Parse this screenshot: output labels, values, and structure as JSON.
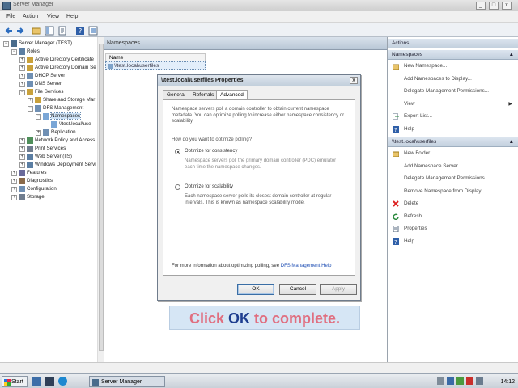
{
  "window": {
    "title": "Server Manager",
    "controls": [
      "_",
      "□",
      "x"
    ]
  },
  "menu": [
    "File",
    "Action",
    "View",
    "Help"
  ],
  "tree": {
    "items": [
      {
        "label": "Server Manager (TEST)",
        "depth": 0,
        "exp": "−"
      },
      {
        "label": "Roles",
        "depth": 1,
        "exp": "−"
      },
      {
        "label": "Active Directory Certificate",
        "depth": 2,
        "exp": "+"
      },
      {
        "label": "Active Directory Domain Se",
        "depth": 2,
        "exp": "+"
      },
      {
        "label": "DHCP Server",
        "depth": 2,
        "exp": "+"
      },
      {
        "label": "DNS Server",
        "depth": 2,
        "exp": "+"
      },
      {
        "label": "File Services",
        "depth": 2,
        "exp": "−"
      },
      {
        "label": "Share and Storage Mar",
        "depth": 3,
        "exp": "+"
      },
      {
        "label": "DFS Management",
        "depth": 3,
        "exp": "−"
      },
      {
        "label": "Namespaces",
        "depth": 4,
        "exp": "−",
        "selected": true
      },
      {
        "label": "\\\\test.local\\use",
        "depth": 5,
        "exp": ""
      },
      {
        "label": "Replication",
        "depth": 4,
        "exp": "+"
      },
      {
        "label": "Network Policy and Access",
        "depth": 2,
        "exp": "+"
      },
      {
        "label": "Print Services",
        "depth": 2,
        "exp": "+"
      },
      {
        "label": "Web Server (IIS)",
        "depth": 2,
        "exp": "+"
      },
      {
        "label": "Windows Deployment Servi",
        "depth": 2,
        "exp": "+"
      },
      {
        "label": "Features",
        "depth": 1,
        "exp": "+"
      },
      {
        "label": "Diagnostics",
        "depth": 1,
        "exp": "+"
      },
      {
        "label": "Configuration",
        "depth": 1,
        "exp": "+"
      },
      {
        "label": "Storage",
        "depth": 1,
        "exp": "+"
      }
    ]
  },
  "center": {
    "header": "Namespaces",
    "column": "Name",
    "row": "\\\\test.local\\userfiles"
  },
  "actions": {
    "title": "Actions",
    "section1": {
      "title": "Namespaces",
      "items": [
        {
          "label": "New Namespace...",
          "icon": "folder-icon"
        },
        {
          "label": "Add Namespaces to Display...",
          "icon": "none"
        },
        {
          "label": "Delegate Management Permissions...",
          "icon": "none"
        },
        {
          "label": "View",
          "icon": "none",
          "submenu": true
        },
        {
          "label": "Export List...",
          "icon": "export-icon"
        },
        {
          "label": "Help",
          "icon": "help-icon"
        }
      ]
    },
    "section2": {
      "title": "\\\\test.local\\userfiles",
      "items": [
        {
          "label": "New Folder...",
          "icon": "folder-icon"
        },
        {
          "label": "Add Namespace Server...",
          "icon": "none"
        },
        {
          "label": "Delegate Management Permissions...",
          "icon": "none"
        },
        {
          "label": "Remove Namespace from Display...",
          "icon": "none"
        },
        {
          "label": "Delete",
          "icon": "delete-icon"
        },
        {
          "label": "Refresh",
          "icon": "refresh-icon"
        },
        {
          "label": "Properties",
          "icon": "properties-icon"
        },
        {
          "label": "Help",
          "icon": "help-icon"
        }
      ]
    }
  },
  "dialog": {
    "title": "\\\\test.local\\userfiles Properties",
    "close": "x",
    "tabs": [
      "General",
      "Referrals",
      "Advanced"
    ],
    "active_tab": "Advanced",
    "intro": "Namespace servers poll a domain controller to obtain current namespace metadata. You can optimize polling to increase either namespace consistency or scalability.",
    "question": "How do you want to optimize polling?",
    "option1": {
      "label": "Optimize for consistency",
      "desc": "Namespace servers poll the primary domain controller (PDC) emulator each time the namespace changes.",
      "selected": true
    },
    "option2": {
      "label": "Optimize for scalability",
      "desc": "Each namespace server polls its closest domain controller at regular intervals. This is known as namespace scalability mode.",
      "selected": false
    },
    "more_info": "For more information about optimizing polling, see",
    "link": "DFS Management Help",
    "buttons": {
      "ok": "OK",
      "cancel": "Cancel",
      "apply": "Apply"
    }
  },
  "banner": {
    "pre": "Click ",
    "strong": "OK",
    "post": " to complete."
  },
  "taskbar": {
    "start": "Start",
    "task": "Server Manager",
    "clock": "14:12"
  }
}
